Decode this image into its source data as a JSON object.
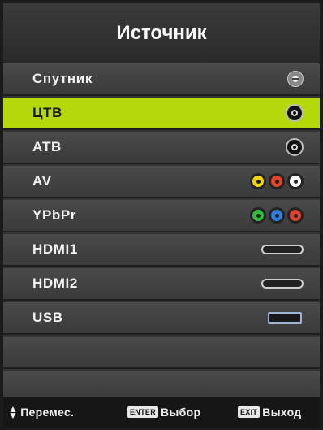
{
  "menu": {
    "title": "Источник",
    "items": [
      {
        "label": "Спутник",
        "icon": "satellite-icon",
        "selected": false
      },
      {
        "label": "ЦТВ",
        "icon": "antenna-icon",
        "selected": true
      },
      {
        "label": "АТВ",
        "icon": "antenna-icon",
        "selected": false
      },
      {
        "label": "AV",
        "icon": "av-rca-icon",
        "selected": false
      },
      {
        "label": "YPbPr",
        "icon": "component-rca-icon",
        "selected": false
      },
      {
        "label": "HDMI1",
        "icon": "hdmi-icon",
        "selected": false
      },
      {
        "label": "HDMI2",
        "icon": "hdmi-icon",
        "selected": false
      },
      {
        "label": "USB",
        "icon": "usb-icon",
        "selected": false
      }
    ]
  },
  "footer": {
    "move_label": "Перемес.",
    "enter_key": "ENTER",
    "select_label": "Выбор",
    "exit_key": "EXIT",
    "exit_label": "Выход"
  },
  "colors": {
    "highlight": "#b4d90b",
    "av": [
      "#f2d500",
      "#e0432a",
      "#ffffff"
    ],
    "ypbpr": [
      "#2fbf3b",
      "#2f7de0",
      "#e0432a"
    ]
  }
}
